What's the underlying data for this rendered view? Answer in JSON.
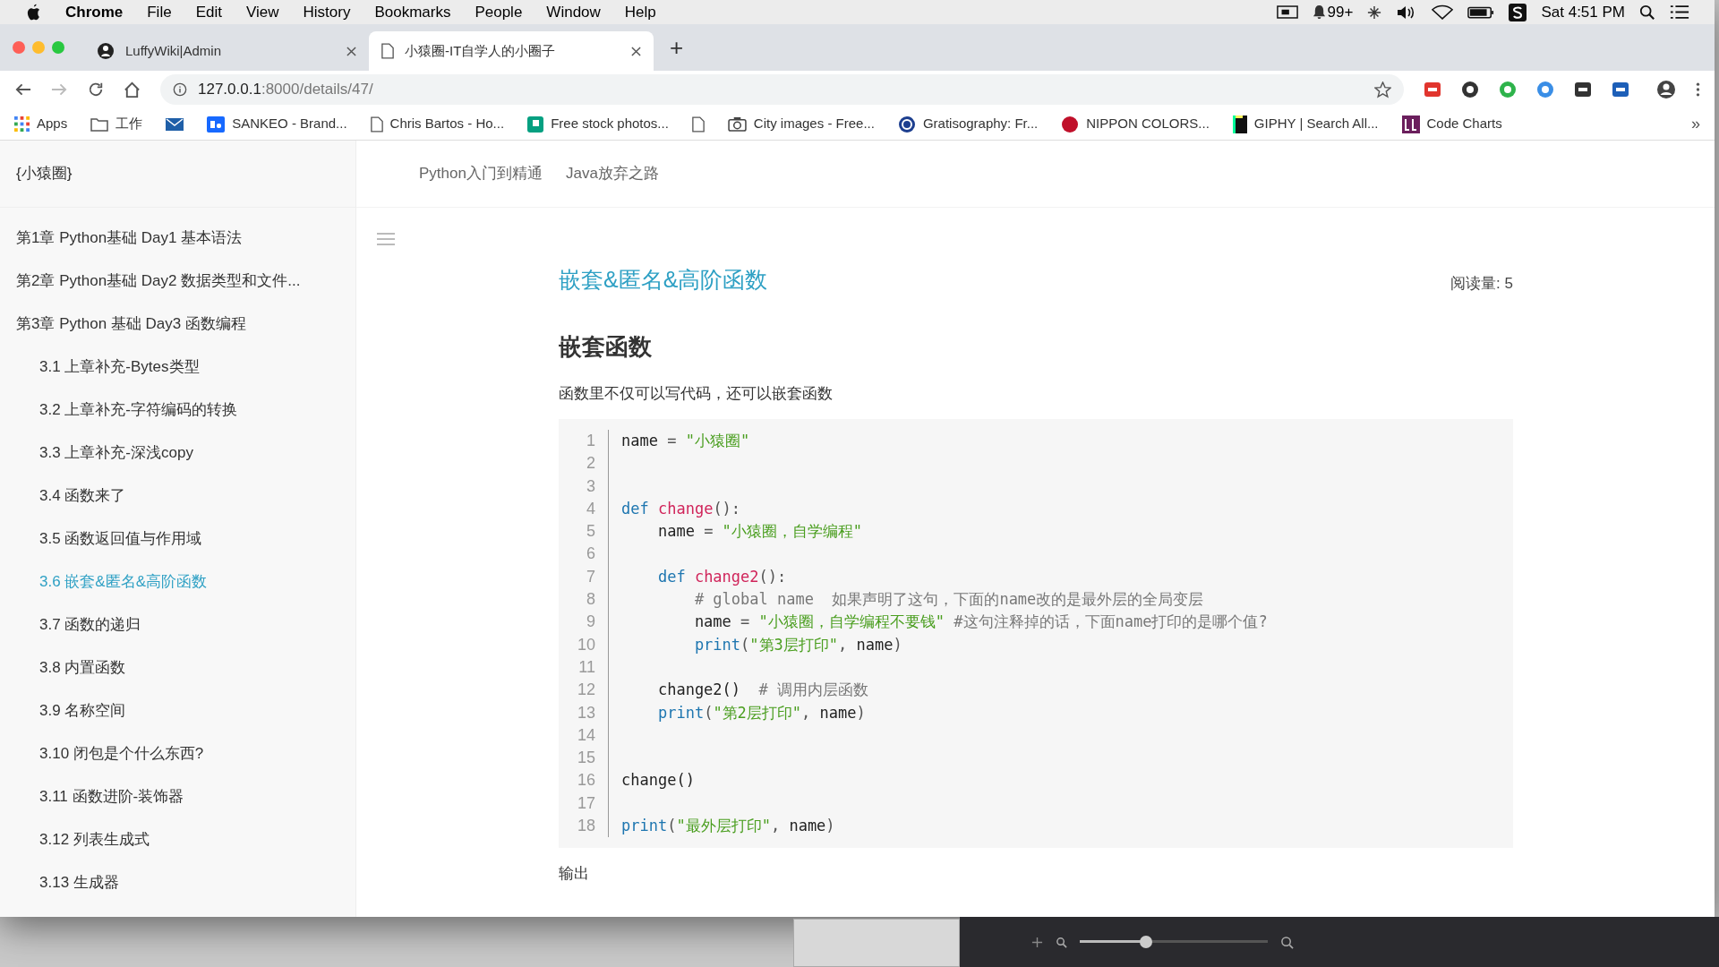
{
  "menu_bar": {
    "app": "Chrome",
    "items": [
      "File",
      "Edit",
      "View",
      "History",
      "Bookmarks",
      "People",
      "Window",
      "Help"
    ],
    "notification_count": "99+",
    "clock": "Sat 4:51 PM"
  },
  "tabs": [
    {
      "title": "LuffyWiki|Admin",
      "selected": false
    },
    {
      "title": "小猿圈-IT自学人的小圈子",
      "selected": true
    }
  ],
  "new_tab": "+",
  "address": {
    "host": "127.0.0.1",
    "rest": ":8000/details/47/"
  },
  "bookmarks": [
    {
      "label": "Apps",
      "kind": "apps"
    },
    {
      "label": "工作",
      "kind": "folder"
    },
    {
      "kind": "mail"
    },
    {
      "label": "SANKEO - Brand...",
      "kind": "behance"
    },
    {
      "label": "Chris Bartos - Ho...",
      "kind": "page"
    },
    {
      "label": "Free stock photos...",
      "kind": "stock"
    },
    {
      "kind": "page"
    },
    {
      "label": "City images - Free...",
      "kind": "camera"
    },
    {
      "label": "Gratisography: Fr...",
      "kind": "cc"
    },
    {
      "label": "NIPPON COLORS...",
      "kind": "dot"
    },
    {
      "label": "GIPHY | Search All...",
      "kind": "giphy"
    },
    {
      "label": "Code Charts",
      "kind": "cc2"
    }
  ],
  "bookmarks_more": "»",
  "sidebar": {
    "brand": "{小猿圈}",
    "items": [
      {
        "label": "第1章 Python基础 Day1 基本语法",
        "selected": false
      },
      {
        "label": "第2章 Python基础 Day2 数据类型和文件...",
        "selected": false
      },
      {
        "label": "第3章 Python 基础 Day3 函数编程",
        "selected": false,
        "children": [
          {
            "label": "3.1 上章补充-Bytes类型",
            "selected": false
          },
          {
            "label": "3.2 上章补充-字符编码的转换",
            "selected": false
          },
          {
            "label": "3.3 上章补充-深浅copy",
            "selected": false
          },
          {
            "label": "3.4 函数来了",
            "selected": false
          },
          {
            "label": "3.5 函数返回值与作用域",
            "selected": false
          },
          {
            "label": "3.6 嵌套&匿名&高阶函数",
            "selected": true
          },
          {
            "label": "3.7 函数的递归",
            "selected": false
          },
          {
            "label": "3.8 内置函数",
            "selected": false
          },
          {
            "label": "3.9 名称空间",
            "selected": false
          },
          {
            "label": "3.10 闭包是个什么东西?",
            "selected": false
          },
          {
            "label": "3.11 函数进阶-装饰器",
            "selected": false
          },
          {
            "label": "3.12 列表生成式",
            "selected": false
          },
          {
            "label": "3.13 生成器",
            "selected": false
          }
        ]
      }
    ]
  },
  "top_nav": [
    "Python入门到精通",
    "Java放弃之路"
  ],
  "article": {
    "title": "嵌套&匿名&高阶函数",
    "views": "阅读量: 5",
    "heading": "嵌套函数",
    "intro": "函数里不仅可以写代码，还可以嵌套函数",
    "code": [
      {
        "number": "1",
        "tokens": [
          {
            "text": "name ",
            "kind": "plain"
          },
          {
            "text": "= ",
            "kind": "op"
          },
          {
            "text": "\"小猿圈\"",
            "kind": "string"
          }
        ]
      },
      {
        "number": "2"
      },
      {
        "number": "3"
      },
      {
        "number": "4",
        "tokens": [
          {
            "text": "def ",
            "kind": "keyword"
          },
          {
            "text": "change",
            "kind": "func"
          },
          {
            "text": "():",
            "kind": "op"
          }
        ]
      },
      {
        "number": "5",
        "tokens": [
          {
            "text": "    name ",
            "kind": "plain"
          },
          {
            "text": "= ",
            "kind": "op"
          },
          {
            "text": "\"小猿圈，自学编程\"",
            "kind": "string"
          }
        ]
      },
      {
        "number": "6"
      },
      {
        "number": "7",
        "tokens": [
          {
            "text": "    def ",
            "kind": "keyword"
          },
          {
            "text": "change2",
            "kind": "func"
          },
          {
            "text": "():",
            "kind": "op"
          }
        ]
      },
      {
        "number": "8",
        "tokens": [
          {
            "text": "        # global name  如果声明了这句，下面的name改的是最外层的全局变层",
            "kind": "comment"
          }
        ]
      },
      {
        "number": "9",
        "tokens": [
          {
            "text": "        name ",
            "kind": "plain"
          },
          {
            "text": "= ",
            "kind": "op"
          },
          {
            "text": "\"小猿圈，自学编程不要钱\"",
            "kind": "string"
          },
          {
            "text": " #这句注释掉的话，下面name打印的是哪个值?",
            "kind": "comment"
          }
        ]
      },
      {
        "number": "10",
        "tokens": [
          {
            "text": "        print",
            "kind": "builtin"
          },
          {
            "text": "(",
            "kind": "op"
          },
          {
            "text": "\"第3层打印\"",
            "kind": "string"
          },
          {
            "text": ", ",
            "kind": "op"
          },
          {
            "text": "name",
            "kind": "plain"
          },
          {
            "text": ")",
            "kind": "op"
          }
        ]
      },
      {
        "number": "11"
      },
      {
        "number": "12",
        "tokens": [
          {
            "text": "    change2() ",
            "kind": "plain"
          },
          {
            "text": " # 调用内层函数",
            "kind": "comment"
          }
        ]
      },
      {
        "number": "13",
        "tokens": [
          {
            "text": "    print",
            "kind": "builtin"
          },
          {
            "text": "(",
            "kind": "op"
          },
          {
            "text": "\"第2层打印\"",
            "kind": "string"
          },
          {
            "text": ", ",
            "kind": "op"
          },
          {
            "text": "name",
            "kind": "plain"
          },
          {
            "text": ")",
            "kind": "op"
          }
        ]
      },
      {
        "number": "14"
      },
      {
        "number": "15"
      },
      {
        "number": "16",
        "tokens": [
          {
            "text": "change()",
            "kind": "plain"
          }
        ]
      },
      {
        "number": "17"
      },
      {
        "number": "18",
        "tokens": [
          {
            "text": "print",
            "kind": "builtin"
          },
          {
            "text": "(",
            "kind": "op"
          },
          {
            "text": "\"最外层打印\"",
            "kind": "string"
          },
          {
            "text": ", ",
            "kind": "op"
          },
          {
            "text": "name",
            "kind": "plain"
          },
          {
            "text": ")",
            "kind": "op"
          }
        ]
      }
    ],
    "output_label": "输出"
  },
  "desktop": {
    "zoom_slider": {
      "level": 0.35
    }
  }
}
